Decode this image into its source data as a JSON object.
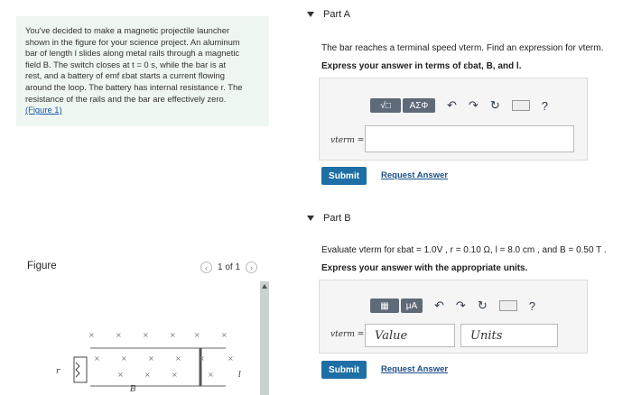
{
  "problem": {
    "lines": [
      "You've decided to make a magnetic projectile launcher",
      "shown in the figure for your science project. An aluminum",
      "bar of length l slides along metal rails through a magnetic",
      "field B. The switch closes at t = 0 s, while the bar is at",
      "rest, and a battery of emf εbat starts a current flowing",
      "around the loop. The battery has internal resistance r. The",
      "resistance of the rails and the bar are effectively zero."
    ],
    "figure_link": "(Figure 1)"
  },
  "figure": {
    "title": "Figure",
    "pager": "1 of 1",
    "prev_icon": "chevron-left-icon",
    "next_icon": "chevron-right-icon",
    "labels": {
      "r": "r",
      "l": "l",
      "B": "B"
    }
  },
  "partA": {
    "heading": "Part A",
    "question": "The bar reaches a terminal speed vterm. Find an expression for vterm.",
    "instruction": "Express your answer in terms of εbat, B, and l.",
    "toolbar": {
      "matrix_label": "√□",
      "greek_label": "ΑΣΦ",
      "help_label": "?"
    },
    "var_label": "vterm =",
    "input_value": "",
    "submit_label": "Submit",
    "request_label": "Request Answer"
  },
  "partB": {
    "heading": "Part B",
    "question": "Evaluate vterm for εbat = 1.0V , r = 0.10 Ω, l = 8.0 cm , and B = 0.50 T .",
    "instruction": "Express your answer with the appropriate units.",
    "toolbar": {
      "units_label": "μA",
      "help_label": "?"
    },
    "var_label": "vterm =",
    "value_placeholder": "Value",
    "units_placeholder": "Units",
    "submit_label": "Submit",
    "request_label": "Request Answer"
  },
  "colors": {
    "accent": "#1d6fa5",
    "panel_bg": "#eef6f1",
    "tool_btn": "#5f6a78"
  }
}
